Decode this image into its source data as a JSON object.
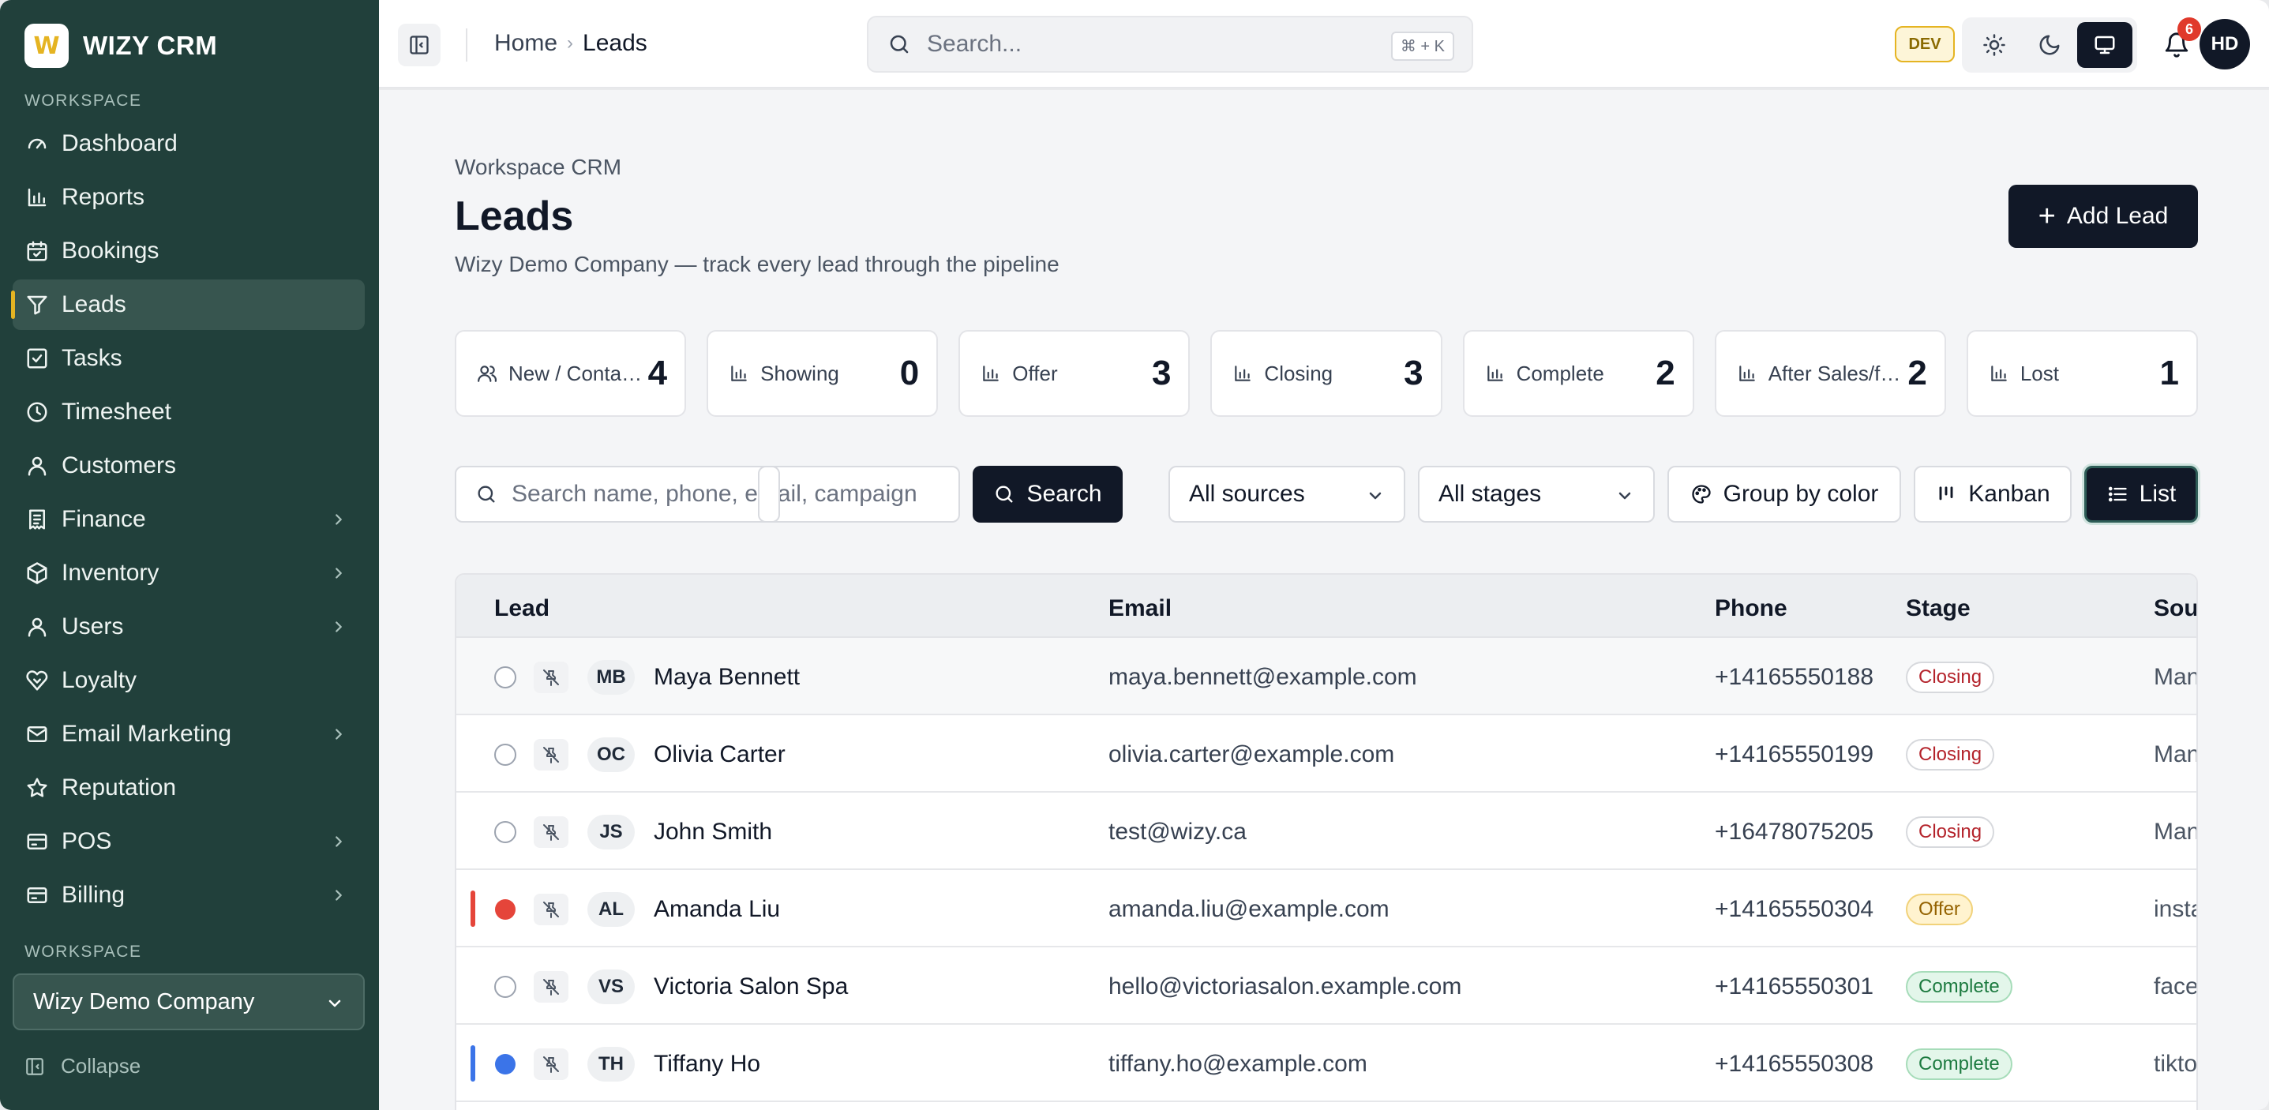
{
  "brand": {
    "logo_letter": "W",
    "name": "WIZY CRM"
  },
  "sidebar": {
    "section_label": "WORKSPACE",
    "items": [
      {
        "label": "Dashboard",
        "icon": "gauge-icon",
        "has_submenu": false,
        "active": false
      },
      {
        "label": "Reports",
        "icon": "bar-chart-icon",
        "has_submenu": false,
        "active": false
      },
      {
        "label": "Bookings",
        "icon": "calendar-icon",
        "has_submenu": false,
        "active": false
      },
      {
        "label": "Leads",
        "icon": "funnel-icon",
        "has_submenu": false,
        "active": true
      },
      {
        "label": "Tasks",
        "icon": "checkbox-icon",
        "has_submenu": false,
        "active": false
      },
      {
        "label": "Timesheet",
        "icon": "clock-icon",
        "has_submenu": false,
        "active": false
      },
      {
        "label": "Customers",
        "icon": "user-icon",
        "has_submenu": false,
        "active": false
      },
      {
        "label": "Finance",
        "icon": "receipt-icon",
        "has_submenu": true,
        "active": false
      },
      {
        "label": "Inventory",
        "icon": "package-icon",
        "has_submenu": true,
        "active": false
      },
      {
        "label": "Users",
        "icon": "user-icon",
        "has_submenu": true,
        "active": false
      },
      {
        "label": "Loyalty",
        "icon": "heart-handshake-icon",
        "has_submenu": false,
        "active": false
      },
      {
        "label": "Email Marketing",
        "icon": "mail-icon",
        "has_submenu": true,
        "active": false
      },
      {
        "label": "Reputation",
        "icon": "star-icon",
        "has_submenu": false,
        "active": false
      },
      {
        "label": "POS",
        "icon": "credit-card-icon",
        "has_submenu": true,
        "active": false
      },
      {
        "label": "Billing",
        "icon": "credit-card-icon",
        "has_submenu": true,
        "active": false
      }
    ],
    "workspace_label": "WORKSPACE",
    "workspace_selected": "Wizy Demo Company",
    "collapse_label": "Collapse"
  },
  "topbar": {
    "breadcrumb": {
      "home": "Home",
      "separator": "›",
      "current": "Leads"
    },
    "search_placeholder": "Search...",
    "search_shortcut": "⌘ + K",
    "env_badge": "DEV",
    "notifications_count": "6",
    "user_initials": "HD"
  },
  "page": {
    "eyebrow": "Workspace CRM",
    "title": "Leads",
    "subtitle": "Wizy Demo Company — track every lead through the pipeline",
    "add_button": "Add Lead"
  },
  "stats": [
    {
      "label": "New / Contacted",
      "value": "4",
      "icon": "users-icon"
    },
    {
      "label": "Showing",
      "value": "0",
      "icon": "bar-chart-icon"
    },
    {
      "label": "Offer",
      "value": "3",
      "icon": "bar-chart-icon"
    },
    {
      "label": "Closing",
      "value": "3",
      "icon": "bar-chart-icon"
    },
    {
      "label": "Complete",
      "value": "2",
      "icon": "bar-chart-icon"
    },
    {
      "label": "After Sales/follow-up",
      "value": "2",
      "icon": "bar-chart-icon"
    },
    {
      "label": "Lost",
      "value": "1",
      "icon": "bar-chart-icon"
    }
  ],
  "toolbar": {
    "search_placeholder": "Search name, phone, email, campaign",
    "search_value": "",
    "search_button": "Search",
    "source_filter": "All sources",
    "stage_filter": "All stages",
    "group_by_color": "Group by color",
    "kanban": "Kanban",
    "list": "List"
  },
  "table": {
    "columns": [
      "Lead",
      "Email",
      "Phone",
      "Stage",
      "Source"
    ],
    "rows": [
      {
        "initials": "MB",
        "name": "Maya Bennett",
        "email": "maya.bennett@example.com",
        "phone": "+14165550188",
        "stage": "Closing",
        "source": "Manual",
        "color": ""
      },
      {
        "initials": "OC",
        "name": "Olivia Carter",
        "email": "olivia.carter@example.com",
        "phone": "+14165550199",
        "stage": "Closing",
        "source": "Manual",
        "color": ""
      },
      {
        "initials": "JS",
        "name": "John Smith",
        "email": "test@wizy.ca",
        "phone": "+16478075205",
        "stage": "Closing",
        "source": "Manual",
        "color": ""
      },
      {
        "initials": "AL",
        "name": "Amanda Liu",
        "email": "amanda.liu@example.com",
        "phone": "+14165550304",
        "stage": "Offer",
        "source": "instagram",
        "color": "#e5453a"
      },
      {
        "initials": "VS",
        "name": "Victoria Salon Spa",
        "email": "hello@victoriasalon.example.com",
        "phone": "+14165550301",
        "stage": "Complete",
        "source": "facebook",
        "color": ""
      },
      {
        "initials": "TH",
        "name": "Tiffany Ho",
        "email": "tiffany.ho@example.com",
        "phone": "+14165550308",
        "stage": "Complete",
        "source": "tiktok",
        "color": "#3b74e8"
      }
    ]
  },
  "colors": {
    "sidebar_bg": "#21403b",
    "sidebar_active": "#37554f",
    "accent": "#e5b422",
    "primary_dark": "#111827",
    "danger": "#e0392b"
  }
}
